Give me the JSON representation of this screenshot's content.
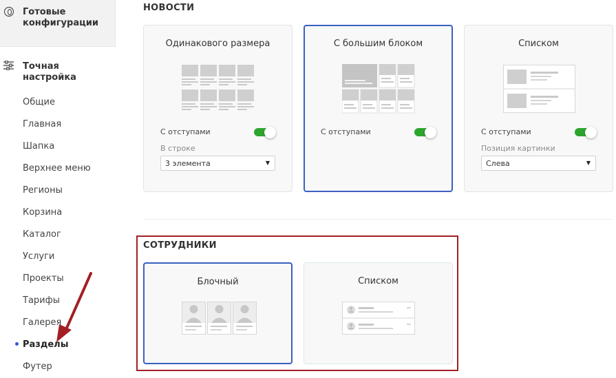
{
  "sidebar": {
    "ready_label": "Готовые конфигурации",
    "tune_label": "Точная настройка",
    "items": [
      {
        "label": "Общие"
      },
      {
        "label": "Главная"
      },
      {
        "label": "Шапка"
      },
      {
        "label": "Верхнее меню"
      },
      {
        "label": "Регионы"
      },
      {
        "label": "Корзина"
      },
      {
        "label": "Каталог"
      },
      {
        "label": "Услуги"
      },
      {
        "label": "Проекты"
      },
      {
        "label": "Тарифы"
      },
      {
        "label": "Галерея"
      },
      {
        "label": "Разделы",
        "active": true
      },
      {
        "label": "Футер"
      }
    ]
  },
  "news": {
    "title": "НОВОСТИ",
    "cards": [
      {
        "title": "Одинакового размера",
        "toggle_label": "С отступами",
        "toggle_on": true,
        "select_label": "В строке",
        "select_value": "3 элемента"
      },
      {
        "title": "С большим блоком",
        "toggle_label": "С отступами",
        "toggle_on": true,
        "selected": true
      },
      {
        "title": "Списком",
        "toggle_label": "С отступами",
        "toggle_on": true,
        "select_label": "Позиция картинки",
        "select_value": "Слева"
      }
    ]
  },
  "staff": {
    "title": "СОТРУДНИКИ",
    "cards": [
      {
        "title": "Блочный",
        "selected": true
      },
      {
        "title": "Списком"
      }
    ]
  },
  "colors": {
    "accent_blue": "#3a5fbf",
    "toggle_green": "#2da52d",
    "highlight_red": "#a31f24"
  }
}
